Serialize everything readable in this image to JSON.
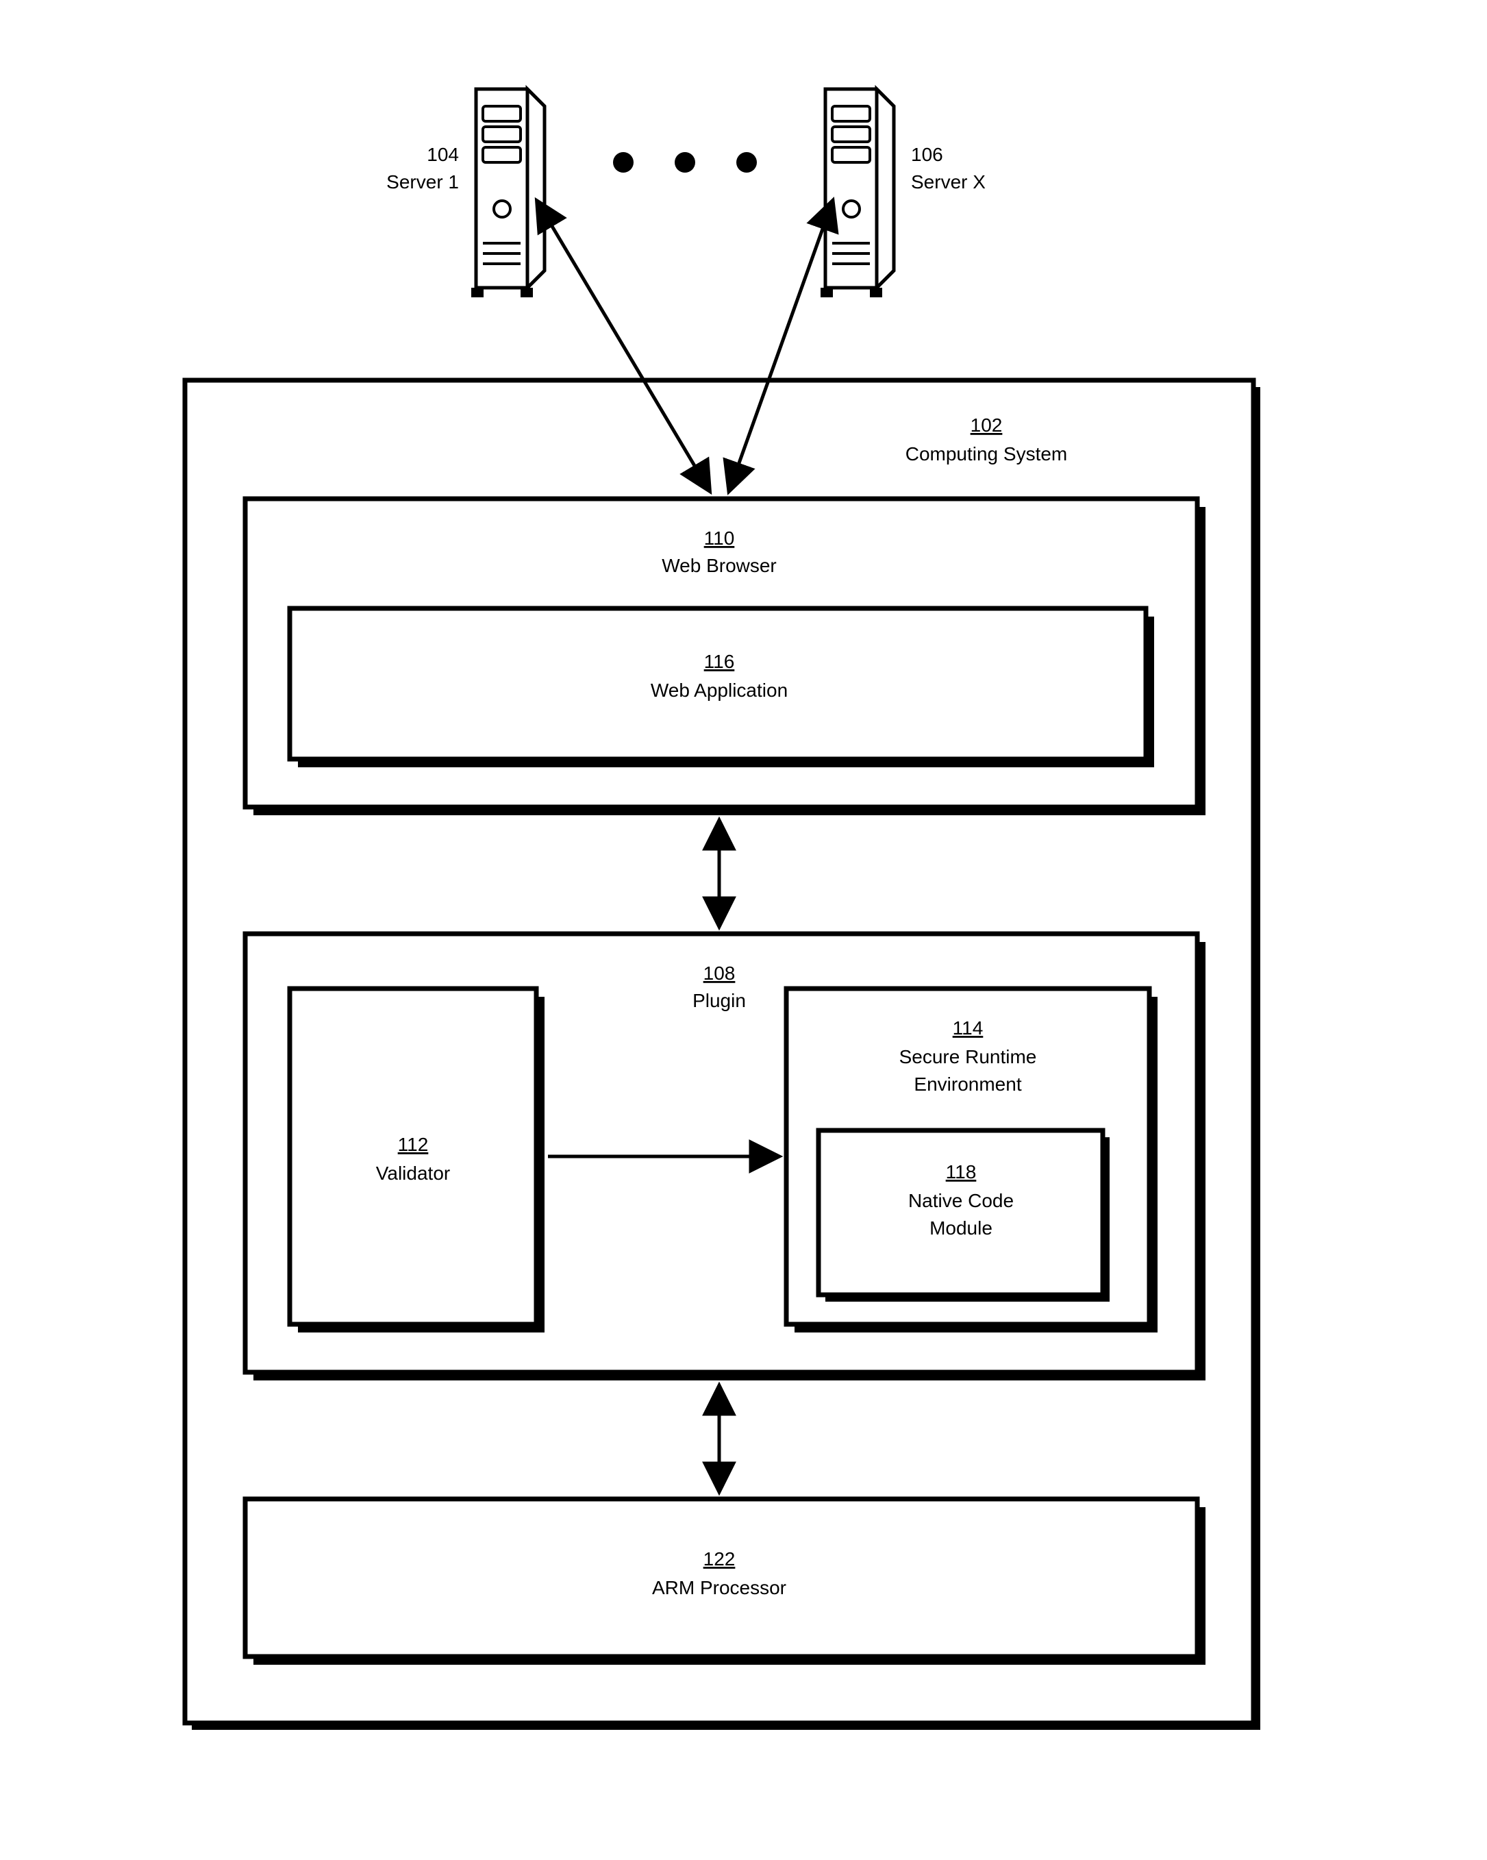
{
  "server1": {
    "num": "104",
    "label": "Server 1"
  },
  "serverX": {
    "num": "106",
    "label": "Server X"
  },
  "computing": {
    "num": "102",
    "label": "Computing System"
  },
  "browser": {
    "num": "110",
    "label": "Web Browser"
  },
  "webapp": {
    "num": "116",
    "label": "Web Application"
  },
  "plugin": {
    "num": "108",
    "label": "Plugin"
  },
  "validator": {
    "num": "112",
    "label": "Validator"
  },
  "sre": {
    "num": "114",
    "label1": "Secure Runtime",
    "label2": "Environment"
  },
  "ncm": {
    "num": "118",
    "label1": "Native Code",
    "label2": "Module"
  },
  "arm": {
    "num": "122",
    "label": "ARM Processor"
  }
}
